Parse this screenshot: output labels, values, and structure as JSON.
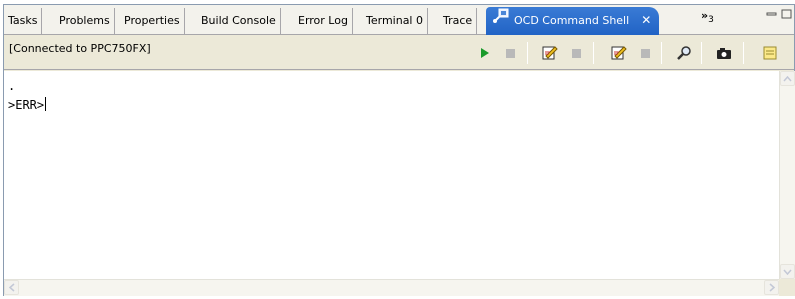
{
  "tabs": [
    {
      "label": "Tasks"
    },
    {
      "label": "Problems"
    },
    {
      "label": "Properties"
    },
    {
      "label": "Build Console"
    },
    {
      "label": "Error Log"
    },
    {
      "label": "Terminal 0"
    },
    {
      "label": "Trace"
    },
    {
      "label": "OCD Command Shell",
      "active": true,
      "icon": "terminal-plug-icon"
    }
  ],
  "overflow": {
    "symbol": "»",
    "count": "3"
  },
  "toolbar": {
    "status": "[Connected to PPC750FX]",
    "icons": [
      "run-icon",
      "stop-icon",
      "edit-icon",
      "stop-icon",
      "edit-icon",
      "stop-icon",
      "search-icon",
      "camera-icon",
      "notes-icon"
    ]
  },
  "console": {
    "lines": [
      ".",
      ">ERR>"
    ]
  },
  "colors": {
    "active_tab": "#2163c5",
    "run_green": "#1a9a2a",
    "disabled_gray": "#b9b9b9"
  }
}
